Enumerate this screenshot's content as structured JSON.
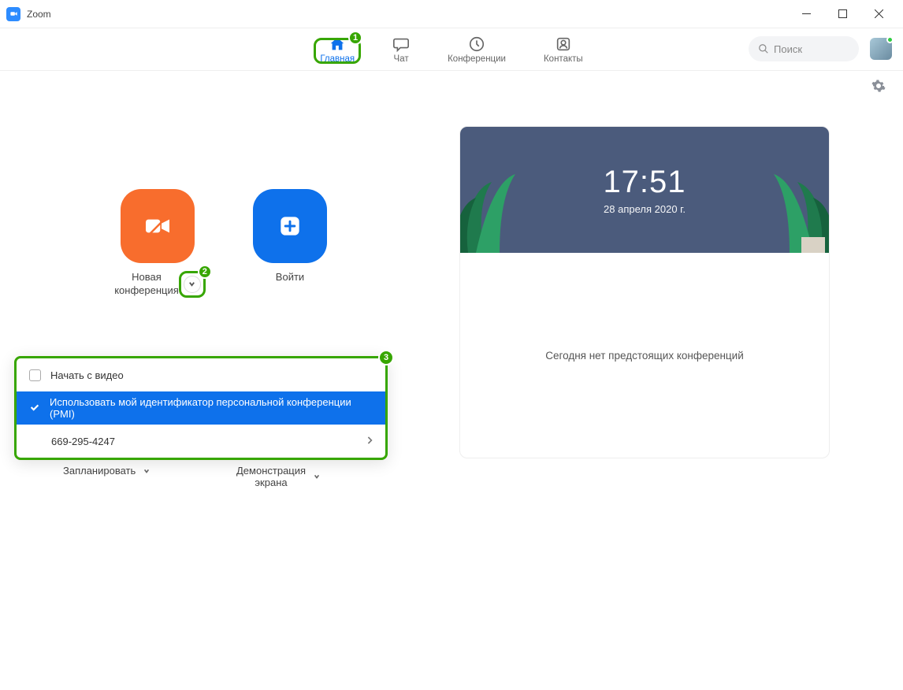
{
  "window": {
    "title": "Zoom"
  },
  "nav": {
    "home": "Главная",
    "chat": "Чат",
    "meetings": "Конференции",
    "contacts": "Контакты",
    "search_placeholder": "Поиск"
  },
  "tiles": {
    "new_meeting": "Новая\nконференция",
    "join": "Войти",
    "schedule": "Запланировать",
    "share": "Демонстрация\nэкрана"
  },
  "dropdown": {
    "start_with_video": "Начать с видео",
    "use_pmi": "Использовать мой идентификатор персональной конференции (PMI)",
    "pmi_number": "669-295-4247"
  },
  "clock": {
    "time": "17:51",
    "date": "28 апреля 2020 г."
  },
  "status": {
    "no_meetings": "Сегодня нет предстоящих конференций"
  },
  "annotations": {
    "b1": "1",
    "b2": "2",
    "b3": "3"
  }
}
